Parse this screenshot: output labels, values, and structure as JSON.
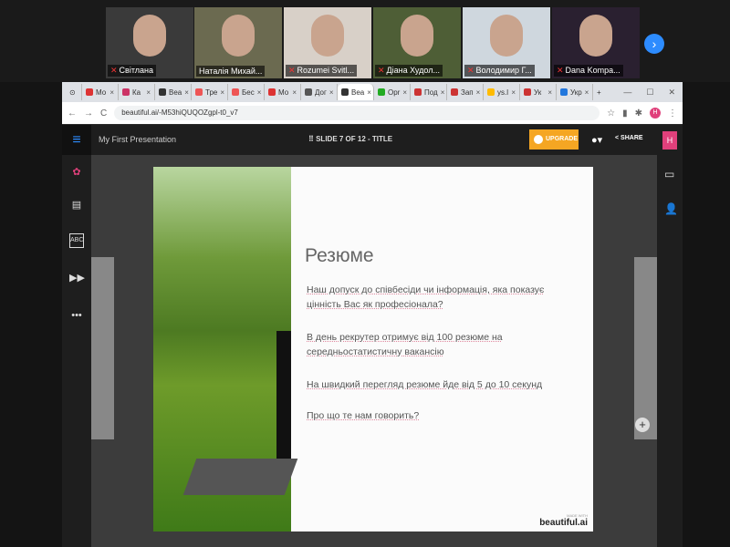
{
  "participants": [
    {
      "name": "Світлана"
    },
    {
      "name": "Наталія Михай..."
    },
    {
      "name": "Rozumei Svitl..."
    },
    {
      "name": "Діана Худол..."
    },
    {
      "name": "Володимир Г..."
    },
    {
      "name": "Dana Kompa..."
    }
  ],
  "next_icon": "chevron-right",
  "browser": {
    "tabs": [
      "Мо",
      "Ка",
      "Bea",
      "Тре",
      "Бес",
      "Мо",
      "Дог",
      "Bea",
      "Opr",
      "Под",
      "Зап",
      "ys.l",
      "Ук",
      "Укр"
    ],
    "new_tab": "+",
    "url": "beautiful.ai/-M53hiQUQOZgpl-t0_v7",
    "profile": "H"
  },
  "app": {
    "title": "My First Presentation",
    "slide_info": "SLIDE 7 OF 12 - TITLE",
    "upgrade": "UPGRADE",
    "share": "SHARE",
    "user": "H"
  },
  "slide": {
    "title": "Резюме",
    "paragraphs": [
      "Наш допуск до співбесіди чи інформація, яка показує цінність Вас як професіонала?",
      "В день рекрутер отримує від 100 резюме на середньостатистичну вакансію",
      "На швидкий перегляд резюме йде від 5 до 10 секунд",
      "Про що те нам говорить?"
    ],
    "made_with": "MADE WITH",
    "brand": "beautiful.ai"
  },
  "colors": {
    "accent": "#2d8cff",
    "upgrade": "#f5a623",
    "user": "#e0407b"
  }
}
